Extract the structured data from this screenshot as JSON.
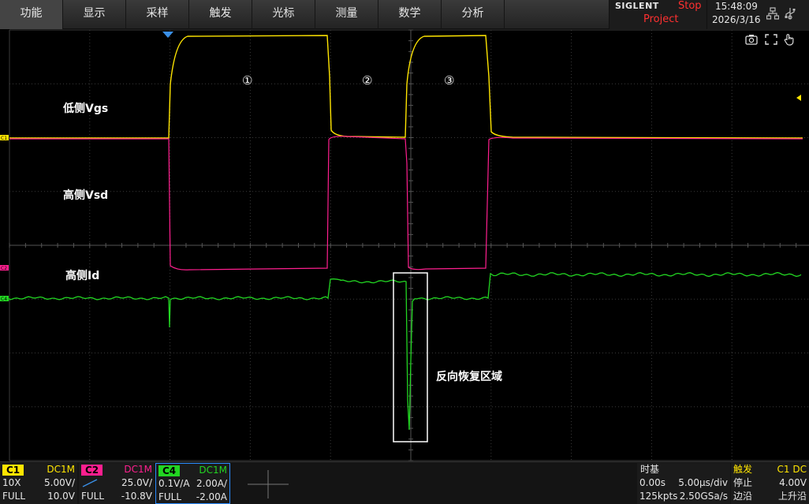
{
  "menu": [
    "功能",
    "显示",
    "采样",
    "触发",
    "光标",
    "测量",
    "数学",
    "分析"
  ],
  "status": {
    "brand": "SIGLENT",
    "run_state": "Stop",
    "project": "Project",
    "time": "15:48:09",
    "date": "2026/3/16"
  },
  "icons": {
    "network": "network-icon",
    "usb": "usb-icon",
    "camera": "camera-icon",
    "fullscreen": "fullscreen-icon",
    "touch": "touch-icon"
  },
  "colors": {
    "ch1": "#ffe500",
    "ch2": "#ff1f8f",
    "ch4": "#22d622",
    "annotation_box": "#ffffff"
  },
  "markers": {
    "c1": "C1",
    "c2": "C2",
    "c4": "C4"
  },
  "annotations": {
    "vgs_label": "低侧Vgs",
    "vsd_label": "高侧Vsd",
    "id_label": "高侧Id",
    "reverse_recovery": "反向恢复区域",
    "phase1": "①",
    "phase2": "②",
    "phase3": "③"
  },
  "channels": [
    {
      "tag": "C1",
      "coupling": "DC1M",
      "probe": "10X",
      "scale": "5.00V/",
      "bw": "FULL",
      "offset": "10.0V"
    },
    {
      "tag": "C2",
      "coupling": "DC1M",
      "probe": "",
      "scale": "25.0V/",
      "bw": "FULL",
      "offset": "-10.8V"
    },
    {
      "tag": "C4",
      "coupling": "DC1M",
      "probe": "0.1V/A",
      "scale": "2.00A/",
      "bw": "FULL",
      "offset": "-2.00A"
    }
  ],
  "timebase": {
    "title": "时基",
    "delay": "0.00s",
    "scale": "5.00μs/div",
    "memory": "125kpts",
    "sample_rate": "2.50GSa/s"
  },
  "trigger": {
    "title": "触发",
    "source": "C1 DC",
    "mode": "停止",
    "level": "4.00V",
    "type": "边沿",
    "slope": "上升沿"
  }
}
